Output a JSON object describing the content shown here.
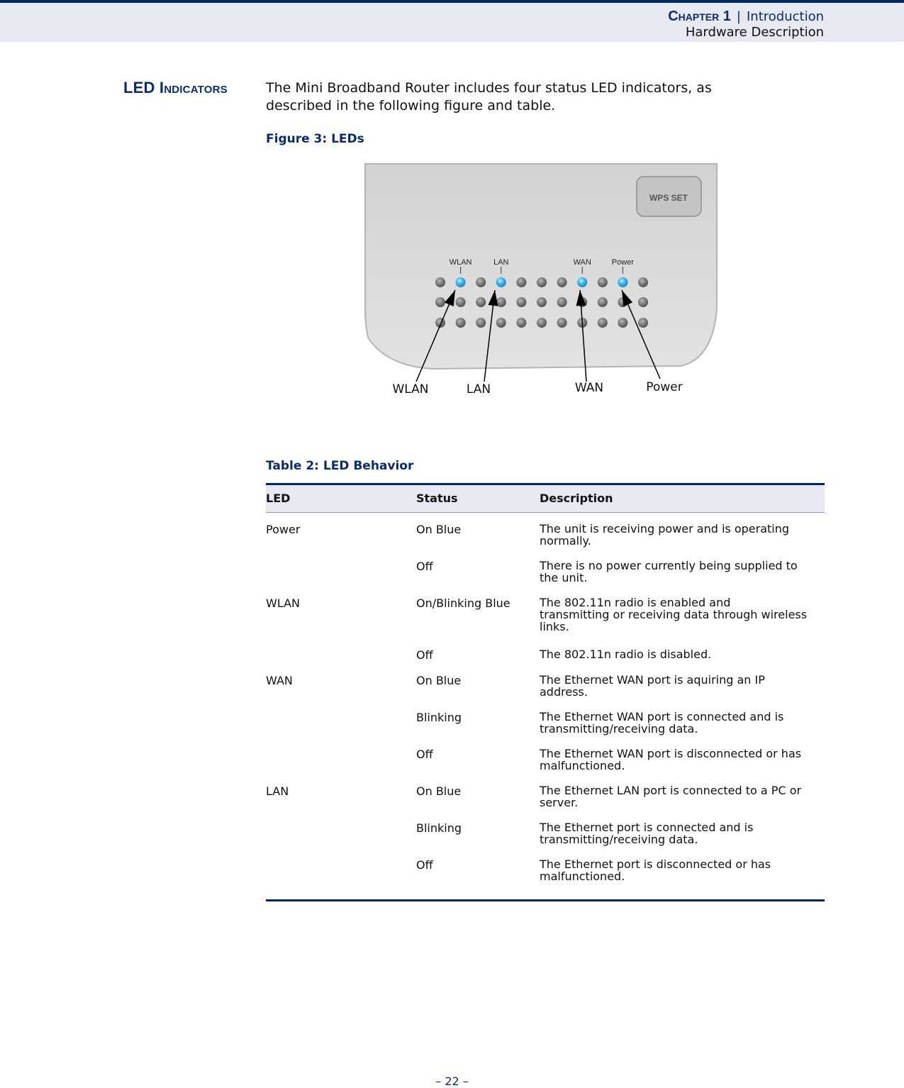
{
  "header": {
    "chapter_label": "Chapter 1",
    "separator": "|",
    "chapter_title": "Introduction",
    "section": "Hardware Description"
  },
  "section": {
    "title": "LED Indicators",
    "intro_line1": "The Mini Broadband Router includes four status LED indicators, as",
    "intro_line2": "described in the following figure and table."
  },
  "figure": {
    "caption": "Figure 3:  LEDs",
    "button_label": "WPS SET",
    "device_labels": [
      "WLAN",
      "LAN",
      "WAN",
      "Power"
    ],
    "callouts": [
      "WLAN",
      "LAN",
      "WAN",
      "Power"
    ],
    "colors": {
      "led_on": "#3fb6ea",
      "led_off": "#7d7d7d",
      "device_body": "#d4d4d4"
    }
  },
  "table": {
    "caption": "Table 2: LED Behavior",
    "columns": [
      "LED",
      "Status",
      "Description"
    ],
    "rows": [
      {
        "led": "Power",
        "status": "On Blue",
        "desc": [
          "The unit is receiving power and is operating",
          "normally."
        ]
      },
      {
        "led": "",
        "status": "Off",
        "desc": [
          "There is no power currently being supplied to",
          "the unit."
        ]
      },
      {
        "led": "WLAN",
        "status": "On/Blinking Blue",
        "desc": [
          "The 802.11n radio is enabled and",
          "transmitting or receiving data through wireless",
          "links."
        ]
      },
      {
        "led": "",
        "status": "Off",
        "desc": [
          "The 802.11n radio is disabled."
        ]
      },
      {
        "led": "WAN",
        "status": "On Blue",
        "desc": [
          "The Ethernet WAN port is aquiring an IP",
          "address."
        ]
      },
      {
        "led": "",
        "status": "Blinking",
        "desc": [
          "The Ethernet WAN port is connected and is",
          "transmitting/receiving data."
        ]
      },
      {
        "led": "",
        "status": "Off",
        "desc": [
          "The Ethernet WAN port is disconnected or has",
          "malfunctioned."
        ]
      },
      {
        "led": "LAN",
        "status": "On Blue",
        "desc": [
          "The Ethernet LAN port is connected to a PC or",
          "server."
        ]
      },
      {
        "led": "",
        "status": "Blinking",
        "desc": [
          "The Ethernet port is connected and is",
          "transmitting/receiving data."
        ]
      },
      {
        "led": "",
        "status": "Off",
        "desc": [
          "The Ethernet port is disconnected or has",
          "malfunctioned."
        ]
      }
    ]
  },
  "footer": {
    "page_number": "–  22  –"
  },
  "colors": {
    "brand_navy": "#00285f",
    "header_bg": "#e6e9f1"
  }
}
